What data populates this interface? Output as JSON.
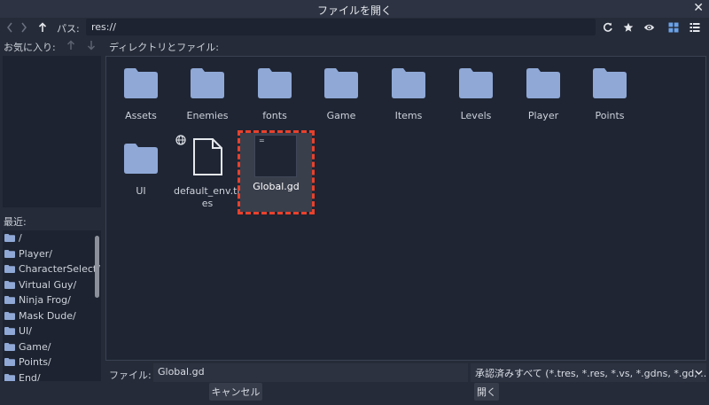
{
  "window": {
    "title": "ファイルを開く",
    "close_glyph": "✕"
  },
  "toolbar": {
    "path_label": "パス:",
    "path_value": "res://",
    "icons": [
      "chevron-left-icon",
      "chevron-right-icon",
      "arrow-up-icon",
      "refresh-icon",
      "star-icon",
      "eye-icon",
      "grid-view-icon",
      "list-view-icon"
    ]
  },
  "favorites": {
    "header": "お気に入り:"
  },
  "recent": {
    "header": "最近:",
    "items": [
      "/",
      "Player/",
      "CharacterSelect/",
      "Virtual Guy/",
      "Ninja Frog/",
      "Mask Dude/",
      "UI/",
      "Game/",
      "Points/",
      "End/"
    ]
  },
  "directory": {
    "header": "ディレクトリとファイル:",
    "folders": [
      "Assets",
      "Enemies",
      "fonts",
      "Game",
      "Items",
      "Levels",
      "Player",
      "Points",
      "UI"
    ],
    "files": [
      {
        "name": "default_env.tres",
        "icon": "file-icon"
      },
      {
        "name": "Global.gd",
        "icon": "script-icon",
        "thumb_glyph": "=",
        "selected": true
      }
    ]
  },
  "footer": {
    "file_label": "ファイル:",
    "file_value": "Global.gd",
    "filter_value": "承認済みすべて (*.tres, *.res, *.vs, *.gdns, *.gd, ...)",
    "cancel_label": "キャンセル",
    "open_label": "開く"
  },
  "colors": {
    "folder": "#8fa8d6",
    "accent": "#6aa2e8",
    "highlight": "#e8412c"
  }
}
